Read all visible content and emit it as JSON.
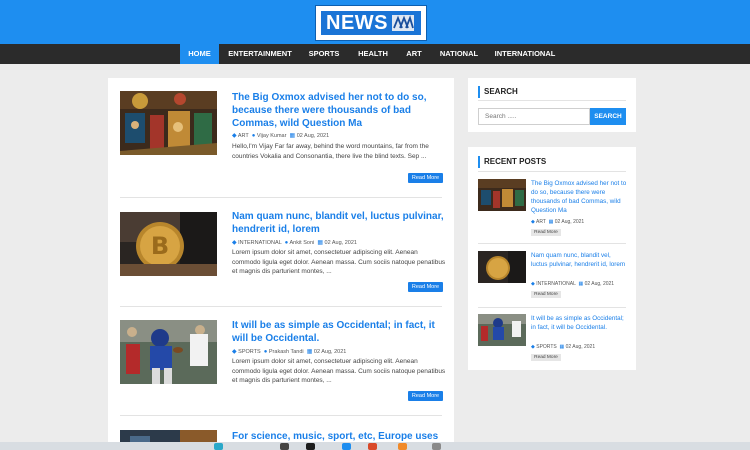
{
  "logo": {
    "text": "NEWS"
  },
  "nav": {
    "items": [
      {
        "label": "HOME",
        "active": true
      },
      {
        "label": "ENTERTAINMENT",
        "active": false
      },
      {
        "label": "SPORTS",
        "active": false
      },
      {
        "label": "HEALTH",
        "active": false
      },
      {
        "label": "ART",
        "active": false
      },
      {
        "label": "NATIONAL",
        "active": false
      },
      {
        "label": "INTERNATIONAL",
        "active": false
      }
    ]
  },
  "posts": [
    {
      "title": "The Big Oxmox advised her not to do so, because there were thousands of bad Commas, wild Question Ma",
      "category": "ART",
      "author": "Vijay Kumar",
      "date": "02 Aug, 2021",
      "excerpt": "Hello,I'm Vijay Far far away, behind the word mountains, far from the countries Vokalia and Consonantia, there live the blind texts. Sep ...",
      "read_more": "Read More"
    },
    {
      "title": "Nam quam nunc, blandit vel, luctus pulvinar, hendrerit id, lorem",
      "category": "INTERNATIONAL",
      "author": "Ankit Soni",
      "date": "02 Aug, 2021",
      "excerpt": "Lorem ipsum dolor sit amet, consectetuer adipiscing elit. Aenean commodo ligula eget dolor. Aenean massa. Cum sociis natoque penatibus et magnis dis parturient montes, ...",
      "read_more": "Read More"
    },
    {
      "title": "It will be as simple as Occidental; in fact, it will be Occidental.",
      "category": "SPORTS",
      "author": "Prakash Tandi",
      "date": "02 Aug, 2021",
      "excerpt": "Lorem ipsum dolor sit amet, consectetuer adipiscing elit. Aenean commodo ligula eget dolor. Aenean massa. Cum sociis natoque penatibus et magnis dis parturient montes, ...",
      "read_more": "Read More"
    },
    {
      "title": "For science, music, sport, etc, Europe uses"
    }
  ],
  "sidebar": {
    "search": {
      "heading": "SEARCH",
      "placeholder": "Search .....",
      "button": "SEARCH"
    },
    "recent": {
      "heading": "RECENT POSTS",
      "items": [
        {
          "title": "The Big Oxmox advised her not to do so, because there were thousands of bad Commas, wild Question Ma",
          "category": "ART",
          "date": "02 Aug, 2021",
          "button": "Read More"
        },
        {
          "title": "Nam quam nunc, blandit vel, luctus pulvinar, hendrerit id, lorem",
          "category": "INTERNATIONAL",
          "date": "02 Aug, 2021",
          "button": "Read More"
        },
        {
          "title": "It will be as simple as Occidental; in fact, it will be Occidental.",
          "category": "SPORTS",
          "date": "02 Aug, 2021",
          "button": "Read More"
        }
      ]
    }
  },
  "colors": {
    "brand": "#1e8ef0",
    "nav_bg": "#2b2b2b",
    "link": "#1a7fe8",
    "page_bg": "#ececec"
  }
}
